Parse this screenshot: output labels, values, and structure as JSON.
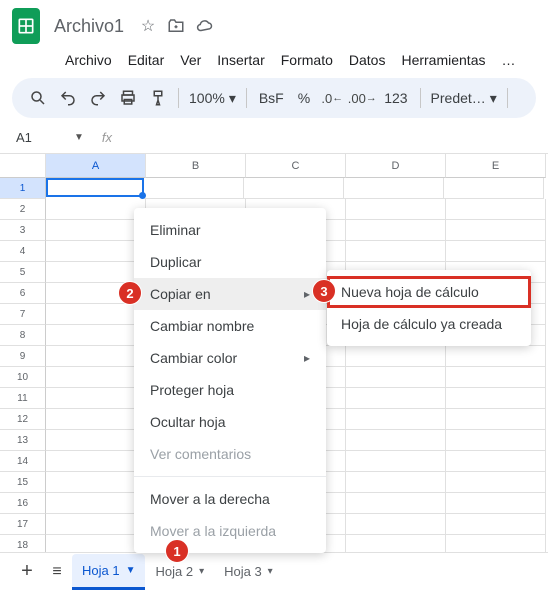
{
  "doc_title": "Archivo1",
  "menu": [
    "Archivo",
    "Editar",
    "Ver",
    "Insertar",
    "Formato",
    "Datos",
    "Herramientas",
    "…"
  ],
  "zoom": "100%",
  "currency": "BsF",
  "percent": "%",
  "num123": "123",
  "font_preset": "Predet…",
  "name_box": "A1",
  "columns": [
    "A",
    "B",
    "C",
    "D",
    "E"
  ],
  "rows": [
    "1",
    "2",
    "3",
    "4",
    "5",
    "6",
    "7",
    "8",
    "9",
    "10",
    "11",
    "12",
    "13",
    "14",
    "15",
    "16",
    "17",
    "18"
  ],
  "tabs": [
    {
      "label": "Hoja 1",
      "active": true
    },
    {
      "label": "Hoja 2",
      "active": false
    },
    {
      "label": "Hoja 3",
      "active": false
    }
  ],
  "context_menu": {
    "delete": "Eliminar",
    "duplicate": "Duplicar",
    "copy_to": "Copiar en",
    "rename": "Cambiar nombre",
    "change_color": "Cambiar color",
    "protect": "Proteger hoja",
    "hide": "Ocultar hoja",
    "comments": "Ver comentarios",
    "move_right": "Mover a la derecha",
    "move_left": "Mover a la izquierda"
  },
  "submenu": {
    "new_spreadsheet": "Nueva hoja de cálculo",
    "existing": "Hoja de cálculo ya creada"
  },
  "markers": {
    "one": "1",
    "two": "2",
    "three": "3"
  }
}
